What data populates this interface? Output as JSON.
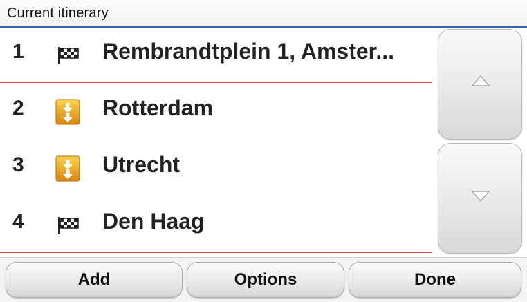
{
  "header": {
    "title": "Current itinerary"
  },
  "itinerary": [
    {
      "number": "1",
      "icon": "checkered-flag-icon",
      "label": "Rembrandtplein 1, Amster..."
    },
    {
      "number": "2",
      "icon": "waypoint-icon",
      "label": "Rotterdam"
    },
    {
      "number": "3",
      "icon": "waypoint-icon",
      "label": "Utrecht"
    },
    {
      "number": "4",
      "icon": "checkered-flag-icon",
      "label": "Den Haag"
    }
  ],
  "scroll": {
    "up_icon": "triangle-up-icon",
    "down_icon": "triangle-down-icon"
  },
  "toolbar": {
    "add_label": "Add",
    "options_label": "Options",
    "done_label": "Done"
  },
  "colors": {
    "header_rule": "#3a64b8",
    "separator": "#d9534a",
    "waypoint": "#e8a21a"
  }
}
